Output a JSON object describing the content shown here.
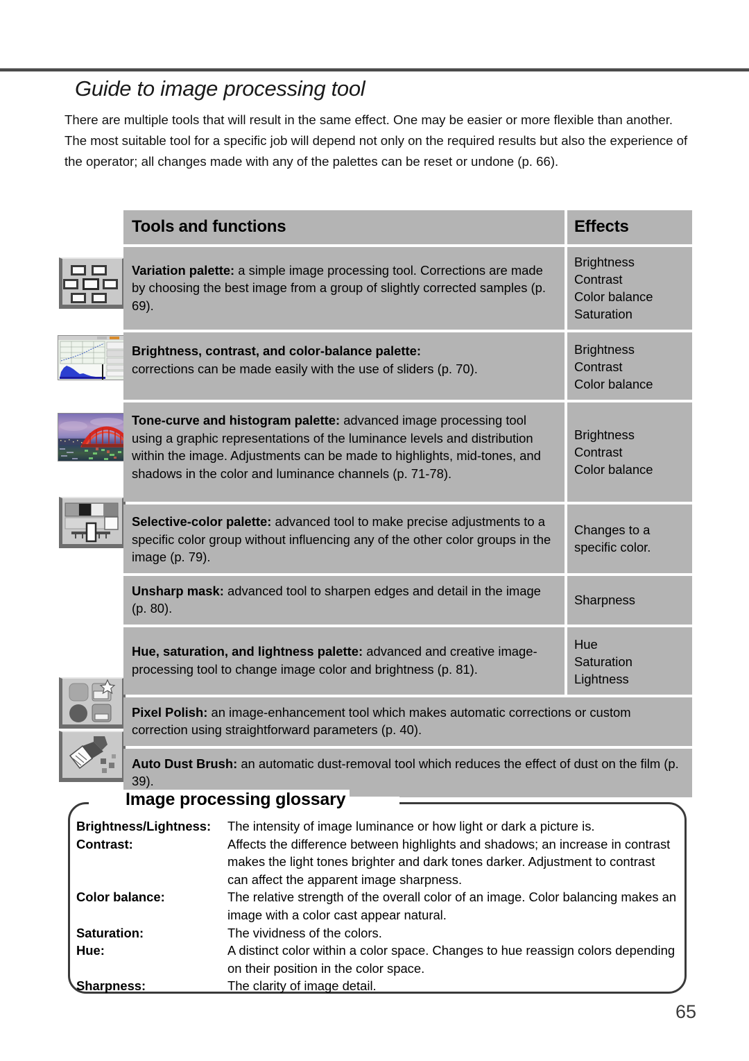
{
  "page": {
    "title": "Guide to image processing tool",
    "intro": "There are multiple tools that will result in the same effect. One may be easier or more flexible than another. The most suitable tool for a specific job will depend not only on the required results but also the experience of the operator; all changes made with any of the palettes can be reset or undone (p. 66).",
    "number": "65",
    "colors": {
      "table_cell_bg": "#b4b4b4",
      "rule": "#4a4a4a",
      "text": "#000000"
    }
  },
  "table": {
    "headers": {
      "tools": "Tools and functions",
      "effects": "Effects"
    },
    "rows": [
      {
        "icon": "variation-palette-icon",
        "term": "Variation palette:",
        "description": " a simple image processing tool. Corrections are made by choosing the best image from a group of slightly corrected samples (p. 69).",
        "effects": "Brightness\nContrast\nColor balance\nSaturation"
      },
      {
        "icon": "brightness-contrast-palette-icon",
        "term": "Brightness, contrast, and color-balance palette:",
        "description": "corrections can be made easily with the use of sliders (p. 70).",
        "effects": "Brightness\nContrast\nColor balance"
      },
      {
        "icon": "tone-curve-histogram-palette-icon",
        "term": "Tone-curve and histogram palette:",
        "description": " advanced image processing tool using a graphic representations of the luminance levels and distribution within the image. Adjustments can be made to highlights, mid-tones, and shadows in the color and luminance channels (p. 71-78).",
        "effects": "Brightness\nContrast\nColor balance"
      },
      {
        "icon": "selective-color-palette-icon",
        "term": "Selective-color palette:",
        "description": " advanced tool to make precise adjustments to a specific color group without influencing any of the other color groups in the image (p. 79).",
        "effects": "Changes to a specific color."
      },
      {
        "icon": "",
        "term": "Unsharp mask:",
        "description": " advanced tool to sharpen edges and detail in the image (p. 80).",
        "effects": "Sharpness"
      },
      {
        "icon": "",
        "term": "Hue, saturation, and lightness palette:",
        "description": " advanced and creative image-processing tool to change image color and brightness (p. 81).",
        "effects": "Hue\nSaturation\nLightness"
      }
    ],
    "full_rows": [
      {
        "icon": "pixel-polish-icon",
        "term": "Pixel Polish:",
        "description": " an image-enhancement tool which makes automatic corrections or custom correction using straightforward parameters (p. 40)."
      },
      {
        "icon": "auto-dust-brush-icon",
        "term": "Auto Dust Brush:",
        "description": " an automatic dust-removal tool which reduces the effect of dust on the film (p. 39)."
      }
    ]
  },
  "glossary": {
    "title": "Image processing glossary",
    "entries": [
      {
        "term": "Brightness/Lightness:",
        "definition": "The intensity of image luminance or how light or dark a picture is."
      },
      {
        "term": "Contrast:",
        "definition": "Affects the difference between highlights and shadows; an increase in contrast makes the light tones brighter and dark tones darker. Adjustment to contrast can affect the apparent image sharpness."
      },
      {
        "term": "Color balance:",
        "definition": "The relative strength of the overall color of an image. Color balancing makes an image with a color cast appear natural."
      },
      {
        "term": "Saturation:",
        "definition": "The vividness of the colors."
      },
      {
        "term": "Hue:",
        "definition": "A distinct color within a color space. Changes to hue reassign colors depending on their position in the color space."
      },
      {
        "term": "Sharpness:",
        "definition": "The clarity of image detail."
      }
    ]
  }
}
